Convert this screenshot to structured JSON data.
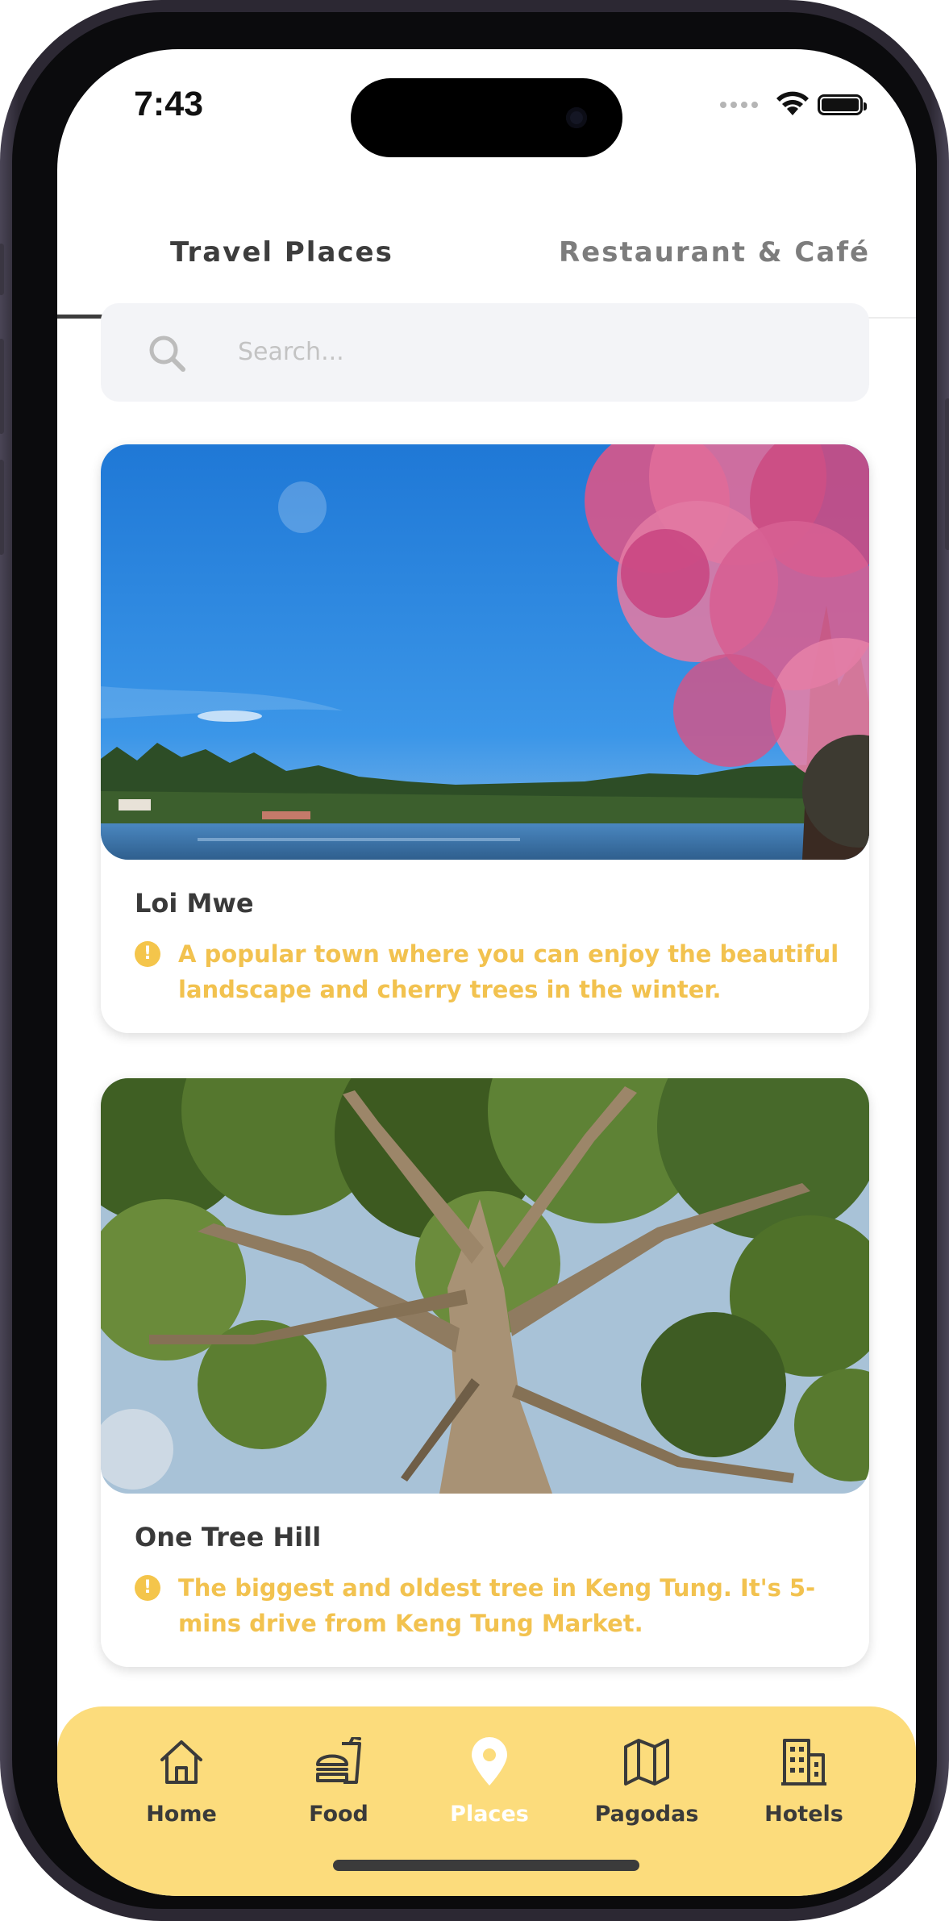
{
  "status_bar": {
    "time": "7:43"
  },
  "tabs": [
    {
      "label": "Travel Places",
      "active": true
    },
    {
      "label": "Restaurant & Café",
      "active": false
    }
  ],
  "search": {
    "placeholder": "Search..."
  },
  "places": [
    {
      "title": "Loi Mwe",
      "description": "A popular town where you can enjoy the beautiful landscape and cherry trees in the winter.",
      "image": "lake-with-cherry-blossom-photo"
    },
    {
      "title": "One Tree Hill",
      "description": "The biggest and oldest tree in Keng Tung. It's 5-mins drive from Keng Tung Market.",
      "image": "large-tree-canopy-photo"
    }
  ],
  "bottom_nav": [
    {
      "label": "Home",
      "icon": "home-icon",
      "active": false
    },
    {
      "label": "Food",
      "icon": "food-icon",
      "active": false
    },
    {
      "label": "Places",
      "icon": "map-pin-icon",
      "active": true
    },
    {
      "label": "Pagodas",
      "icon": "map-icon",
      "active": false
    },
    {
      "label": "Hotels",
      "icon": "building-icon",
      "active": false
    }
  ],
  "colors": {
    "accent_yellow": "#fcdc7c",
    "description_text": "#f2c24f",
    "active_tab_underline": "#3c3c3c"
  }
}
